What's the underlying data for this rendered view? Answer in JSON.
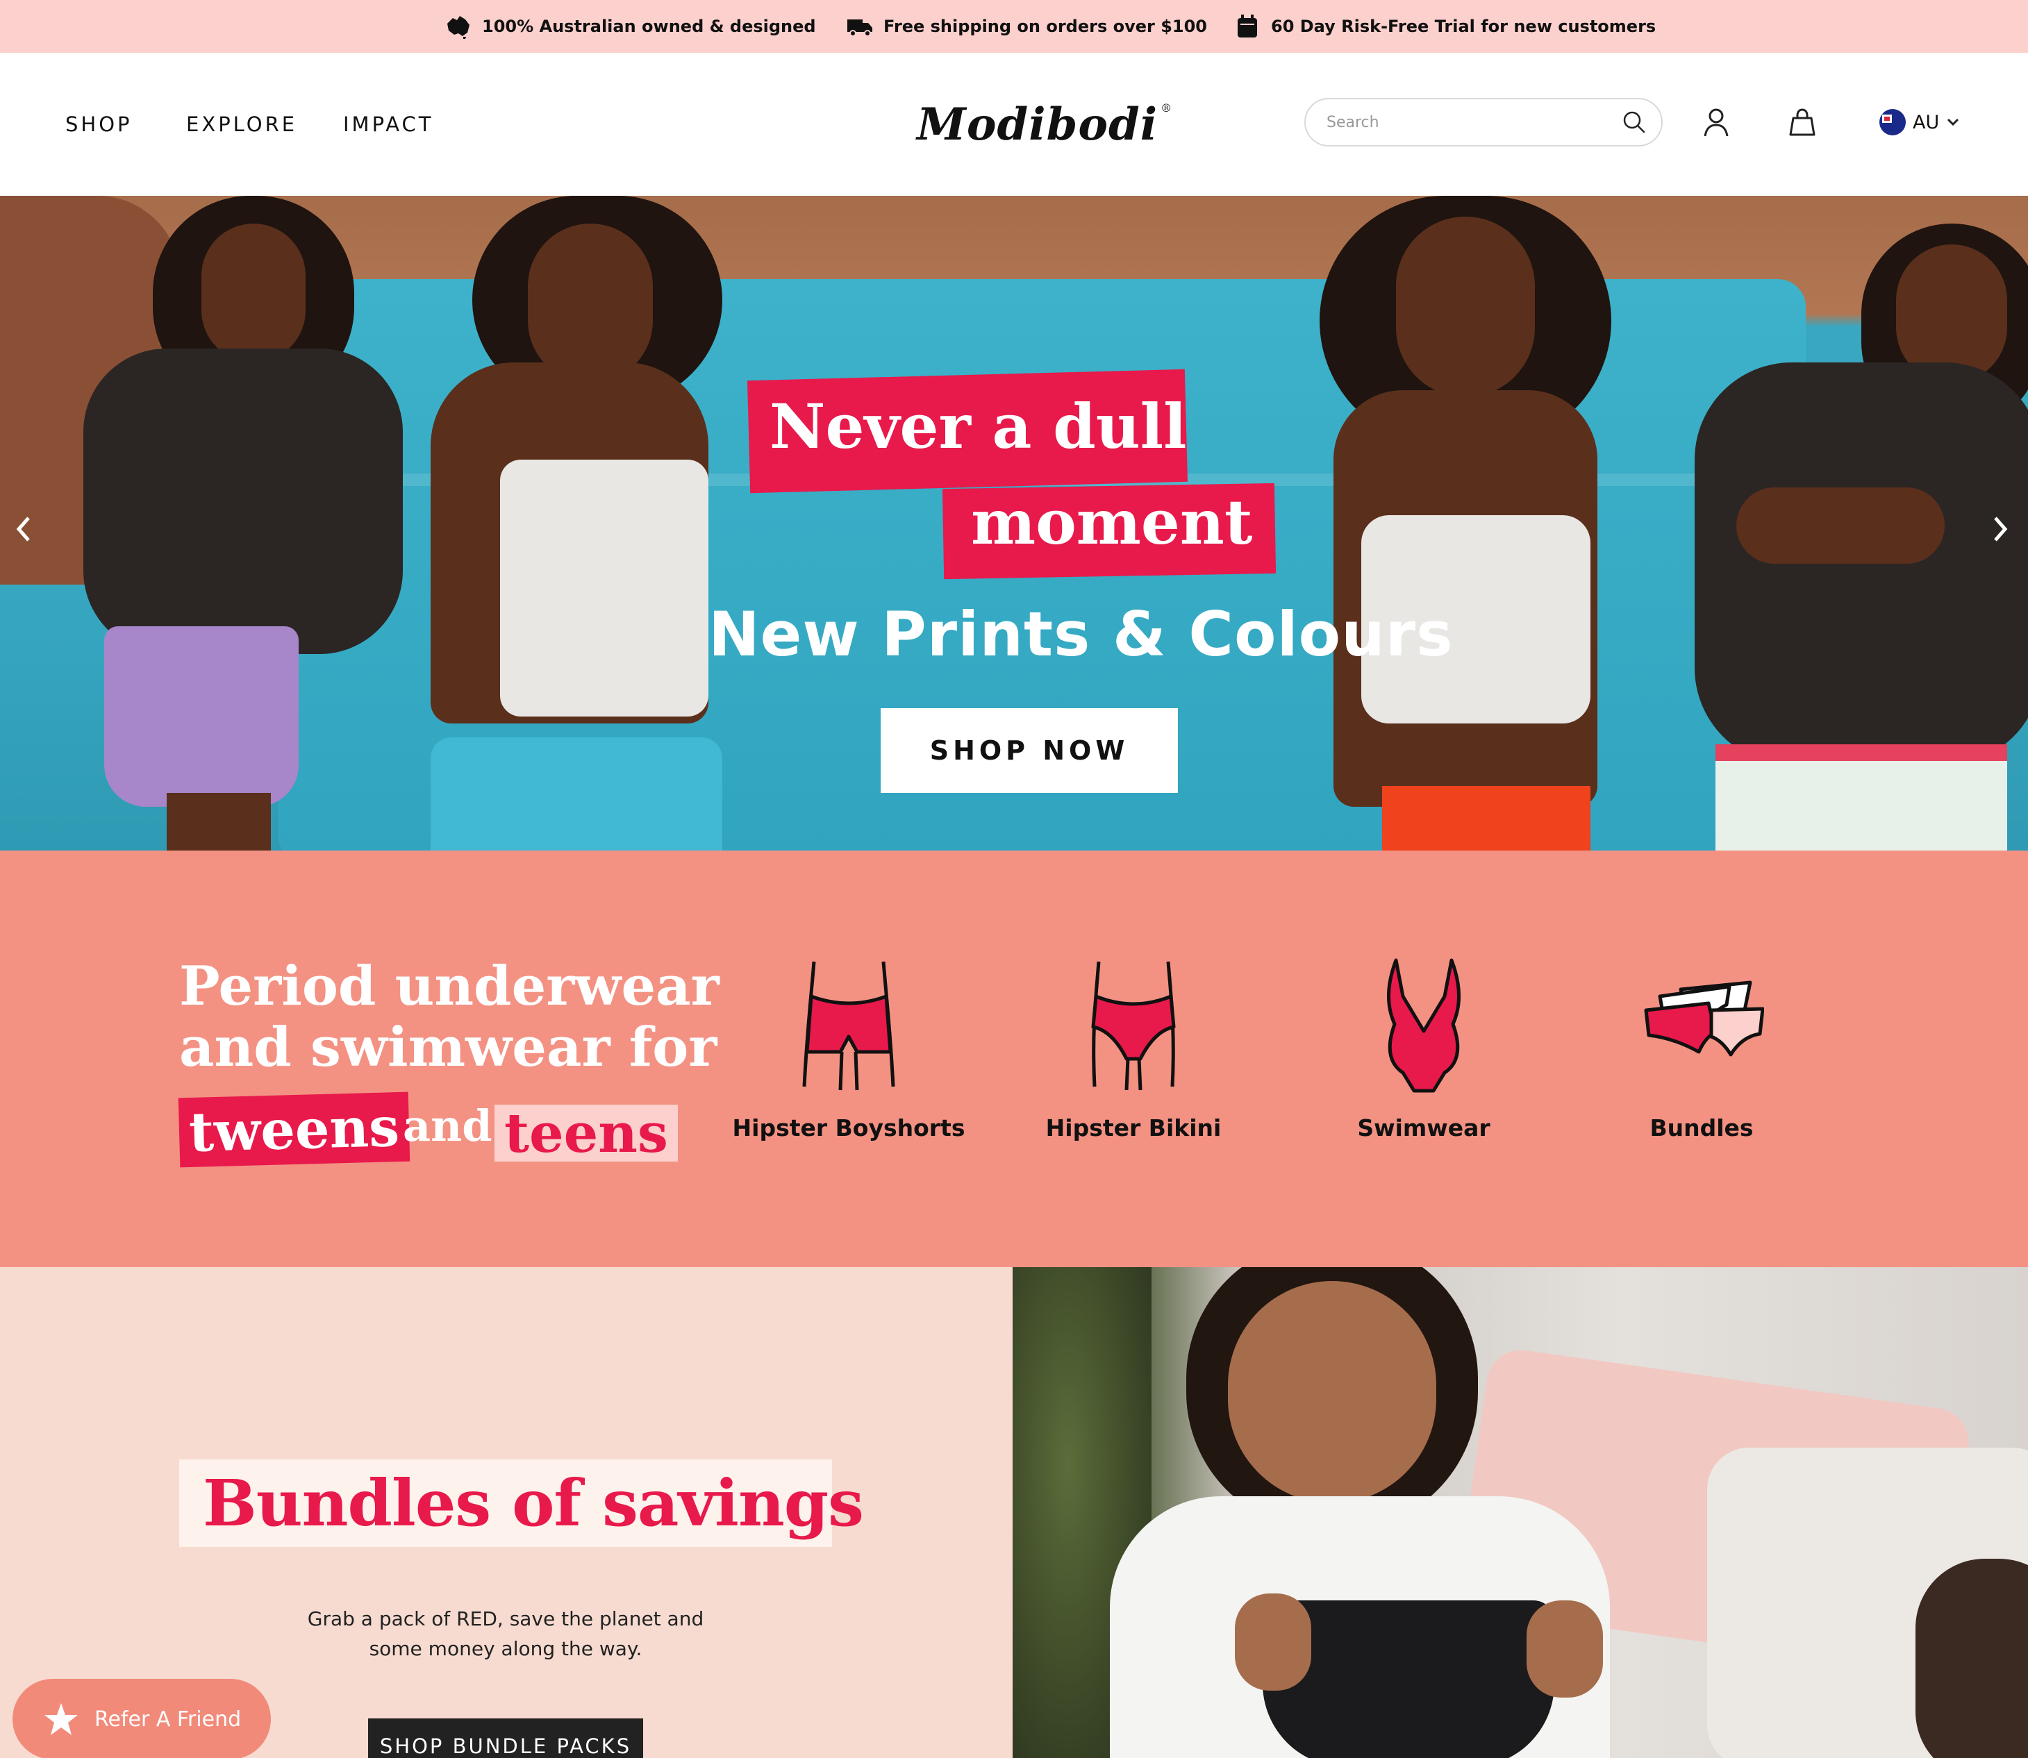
{
  "announcement": {
    "items": [
      {
        "icon": "australia-map-icon",
        "text": "100% Australian owned & designed"
      },
      {
        "icon": "delivery-truck-icon",
        "text": "Free shipping on orders over $100"
      },
      {
        "icon": "calendar-icon",
        "text": "60 Day Risk-Free Trial for new customers"
      }
    ]
  },
  "header": {
    "nav": [
      "SHOP",
      "EXPLORE",
      "IMPACT"
    ],
    "logo": "Modibodi",
    "logo_mark": "®",
    "search_placeholder": "Search",
    "locale": "AU"
  },
  "hero": {
    "headline_line1": "Never a dull",
    "headline_line2": "moment",
    "subheadline": "New Prints & Colours",
    "cta": "SHOP NOW"
  },
  "categories": {
    "heading_line1": "Period underwear",
    "heading_line2": "and swimwear for",
    "highlight1": "tweens",
    "connector": "and",
    "highlight2": "teens",
    "items": [
      {
        "label": "Hipster Boyshorts",
        "icon": "boyshorts-icon"
      },
      {
        "label": "Hipster Bikini",
        "icon": "bikini-icon"
      },
      {
        "label": "Swimwear",
        "icon": "swimsuit-icon"
      },
      {
        "label": "Bundles",
        "icon": "bundle-icon"
      }
    ]
  },
  "bundles": {
    "title": "Bundles of savings",
    "text": "Grab a pack of RED, save the planet and some money along the way.",
    "cta": "SHOP BUNDLE PACKS"
  },
  "refer": {
    "label": "Refer A Friend"
  },
  "colors": {
    "announcement_bg": "#fcd0cc",
    "brand_red": "#e8194b",
    "category_bg": "#f39283",
    "bundles_bg": "#f7dbd0"
  }
}
